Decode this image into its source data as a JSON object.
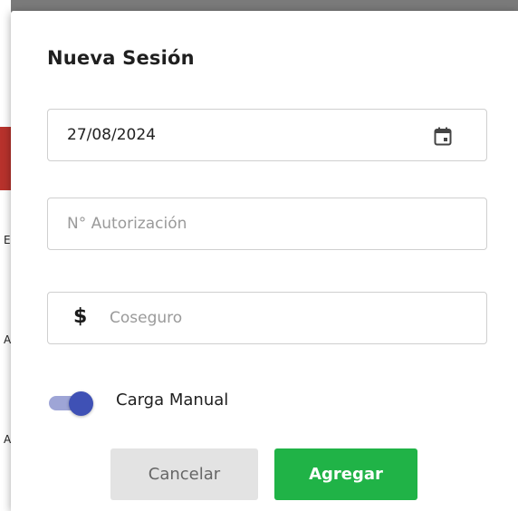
{
  "dialog": {
    "title": "Nueva Sesión",
    "date_field": {
      "value": "27/08/2024",
      "icon": "calendar-icon"
    },
    "authorization_field": {
      "value": "",
      "placeholder": "N° Autorización"
    },
    "copay_field": {
      "value": "",
      "placeholder": "Coseguro",
      "prefix": "$"
    },
    "manual_toggle": {
      "label": "Carga Manual",
      "checked": true
    },
    "buttons": {
      "cancel_label": "Cancelar",
      "add_label": "Agregar"
    }
  },
  "background": {
    "edge_glyphs": [
      "E",
      "A",
      "A"
    ]
  },
  "colors": {
    "accent": "#3f51b5",
    "accent_track": "#9ea5d6",
    "add_button": "#20b347",
    "cancel_button": "#e3e3e3",
    "border": "#cfcfcf",
    "backdrop_red": "#b8322c"
  }
}
